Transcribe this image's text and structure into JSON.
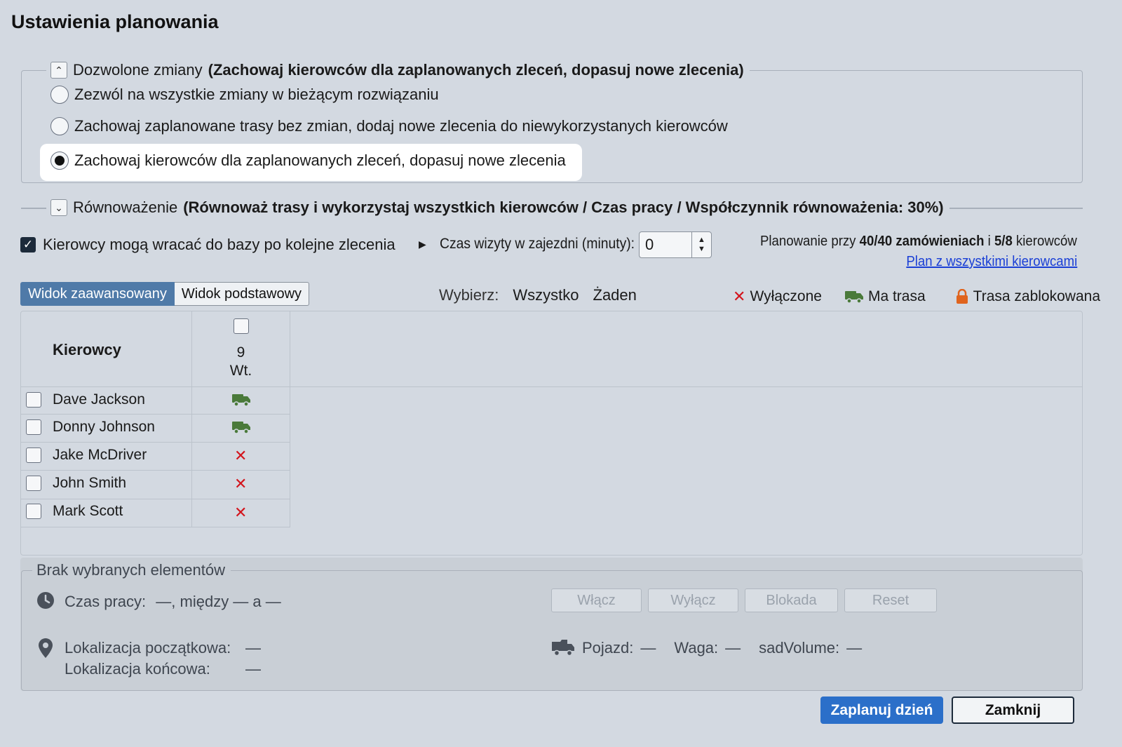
{
  "dialog": {
    "title": "Ustawienia planowania"
  },
  "allowed_changes": {
    "legend_prefix": "Dozwolone zmiany",
    "legend_bold": "(Zachowaj kierowców dla zaplanowanych zleceń, dopasuj nowe zlecenia)",
    "options": [
      {
        "label": "Zezwól na wszystkie zmiany w bieżącym rozwiązaniu",
        "selected": false
      },
      {
        "label": "Zachowaj zaplanowane trasy bez zmian, dodaj nowe zlecenia do niewykorzystanych kierowców",
        "selected": false
      },
      {
        "label": "Zachowaj kierowców dla zaplanowanych zleceń, dopasuj nowe zlecenia",
        "selected": true
      }
    ]
  },
  "balancing": {
    "legend_prefix": "Równoważenie",
    "legend_bold": "(Równoważ trasy i wykorzystaj wszystkich kierowców / Czas pracy / Współczynnik równoważenia: 30%)"
  },
  "options": {
    "return_to_base_label": "Kierowcy mogą wracać do bazy po kolejne zlecenia",
    "return_to_base_checked": true,
    "depot_visit_label": "Czas wizyty w zajezdni (minuty):",
    "depot_visit_value": "0"
  },
  "summary": {
    "prefix": "Planowanie przy",
    "orders": "40/40 zamówieniach",
    "middle": "i",
    "drivers": "5/8",
    "suffix": "kierowców",
    "link": "Plan z wszystkimi kierowcami"
  },
  "tabs": [
    {
      "label": "Widok zaawansowany",
      "active": true
    },
    {
      "label": "Widok podstawowy",
      "active": false
    }
  ],
  "select": {
    "label": "Wybierz:",
    "all": "Wszystko",
    "none": "Żaden"
  },
  "legend_icons": {
    "disabled": "Wyłączone",
    "has_route": "Ma trasa",
    "locked": "Trasa zablokowana"
  },
  "colors": {
    "route_green": "#4a7a3a",
    "disabled_red": "#d3141c",
    "lock_orange": "#e0641e",
    "primary_blue": "#2b6fc9",
    "tab_blue": "#4f7aa8"
  },
  "grid": {
    "drivers_header": "Kierowcy",
    "day_number": "9",
    "day_name": "Wt.",
    "drivers": [
      {
        "name": "Dave Jackson",
        "status": "has_route"
      },
      {
        "name": "Donny Johnson",
        "status": "has_route"
      },
      {
        "name": "Jake McDriver",
        "status": "disabled"
      },
      {
        "name": "John Smith",
        "status": "disabled"
      },
      {
        "name": "Mark Scott",
        "status": "disabled"
      }
    ]
  },
  "selection": {
    "legend": "Brak wybranych elementów",
    "work_time_label": "Czas pracy:",
    "work_time_value": "—, między — a —",
    "start_location_label": "Lokalizacja początkowa:",
    "start_location_value": "—",
    "end_location_label": "Lokalizacja końcowa:",
    "end_location_value": "—",
    "vehicle_label": "Pojazd:",
    "vehicle_value": "—",
    "weight_label": "Waga:",
    "weight_value": "—",
    "volume_label": "sadVolume:",
    "volume_value": "—",
    "buttons": {
      "enable": "Włącz",
      "disable": "Wyłącz",
      "lock": "Blokada",
      "reset": "Reset"
    }
  },
  "footer": {
    "plan_day": "Zaplanuj dzień",
    "close": "Zamknij"
  }
}
